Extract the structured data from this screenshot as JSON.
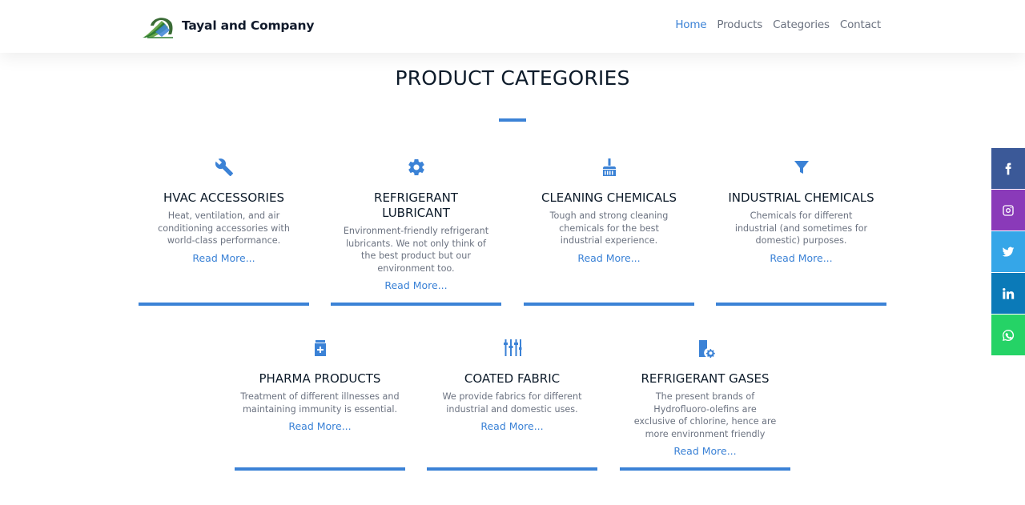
{
  "brand": {
    "name": "Tayal and Company"
  },
  "nav": {
    "items": [
      "Home",
      "Products",
      "Categories",
      "Contact"
    ],
    "active": "Home"
  },
  "section": {
    "title": "PRODUCT CATEGORIES"
  },
  "colors": {
    "accent": "#3b82d6",
    "heading": "#0d1b2a",
    "body_text": "#6b7280"
  },
  "categories": [
    {
      "icon": "wrench-icon",
      "title": "HVAC ACCESSORIES",
      "description": "Heat, ventilation, and air conditioning accessories with world-class performance.",
      "link": "Read More..."
    },
    {
      "icon": "gear-icon",
      "title": "REFRIGERANT LUBRICANT",
      "description": "Environment-friendly refrigerant lubricants. We not only think of the best product but our environment too.",
      "link": "Read More..."
    },
    {
      "icon": "broom-icon",
      "title": "CLEANING CHEMICALS",
      "description": "Tough and strong cleaning chemicals for the best industrial experience.",
      "link": "Read More..."
    },
    {
      "icon": "funnel-icon",
      "title": "INDUSTRIAL CHEMICALS",
      "description": "Chemicals for different industrial (and sometimes for domestic) purposes.",
      "link": "Read More..."
    },
    {
      "icon": "medicine-bottle-icon",
      "title": "PHARMA PRODUCTS",
      "description": "Treatment of different illnesses and maintaining immunity is essential.",
      "link": "Read More..."
    },
    {
      "icon": "sliders-icon",
      "title": "COATED FABRIC",
      "description": "We provide fabrics for different industrial and domestic uses.",
      "link": "Read More..."
    },
    {
      "icon": "gas-cylinder-gear-icon",
      "title": "REFRIGERANT GASES",
      "description": "The present brands of Hydrofluoro-olefins are exclusive of chlorine, hence are more environment friendly",
      "link": "Read More..."
    }
  ],
  "social": [
    {
      "icon": "facebook-icon",
      "color": "#3b5998"
    },
    {
      "icon": "instagram-icon",
      "color": "#8a3ab9"
    },
    {
      "icon": "twitter-icon",
      "color": "#35a6e8"
    },
    {
      "icon": "linkedin-icon",
      "color": "#0b7ab8"
    },
    {
      "icon": "whatsapp-icon",
      "color": "#25d366"
    }
  ]
}
